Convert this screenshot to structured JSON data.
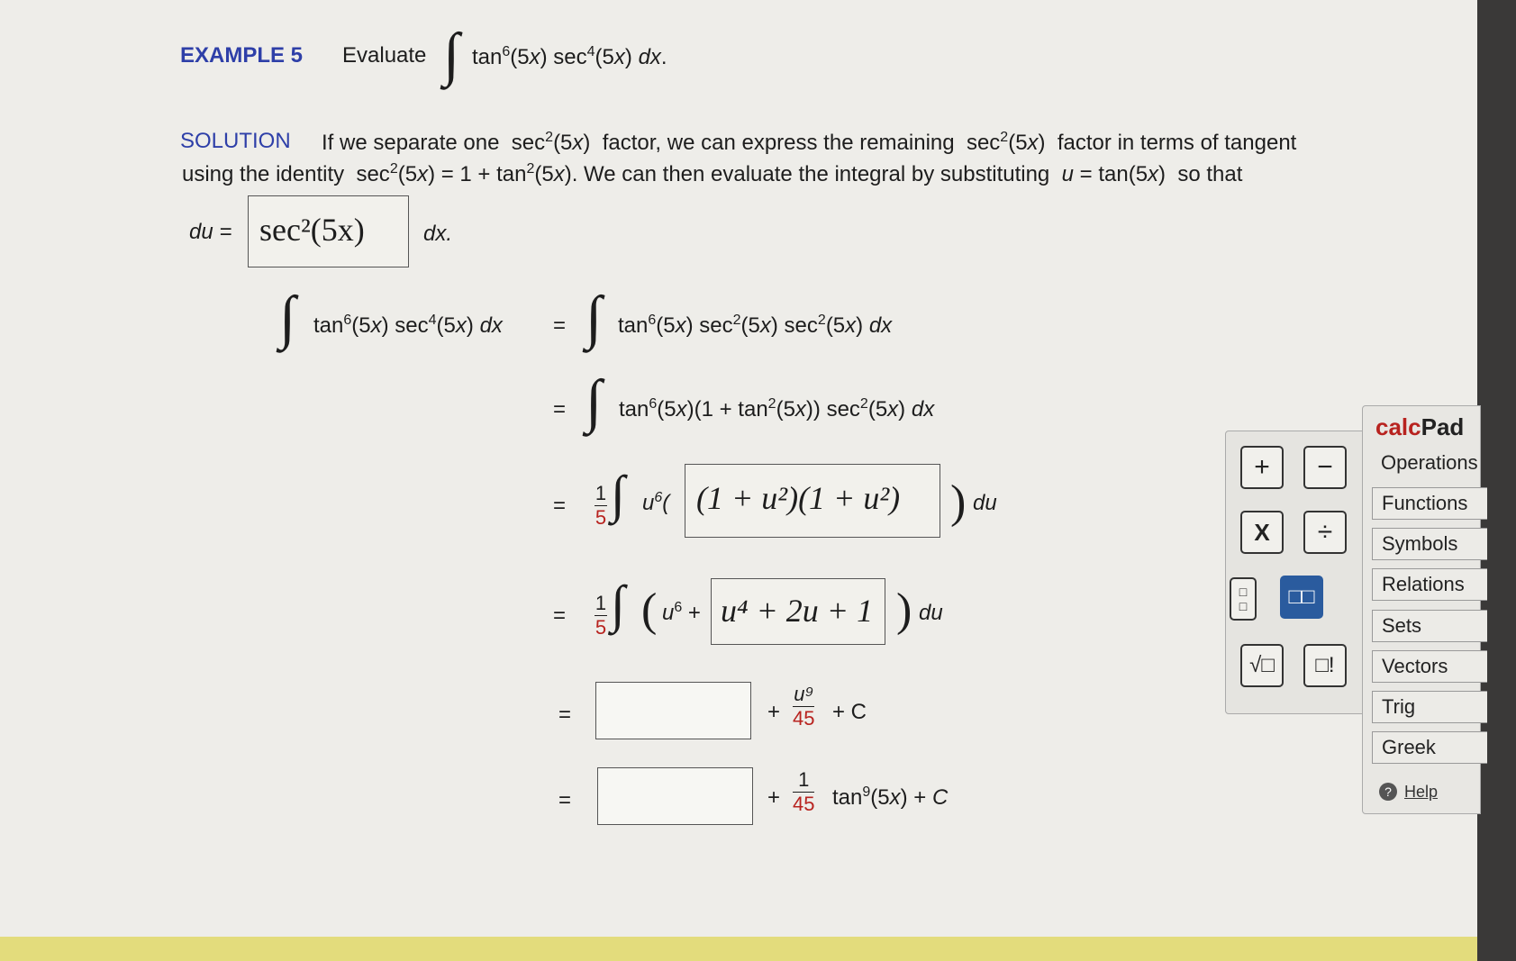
{
  "example": {
    "label": "EXAMPLE 5",
    "evaluate": "Evaluate",
    "integrand": "tan6(5x) sec4(5x) dx."
  },
  "solution": {
    "label": "SOLUTION",
    "line1a": "If we separate one",
    "line1b": "factor, we can express the remaining",
    "line1c": "factor in terms of tangent",
    "line2a": "using the identity",
    "line2b": ". We can then evaluate the integral by substituting",
    "line2c": "so that",
    "du_label": "du =",
    "du_box": "sec²(5x)",
    "dx_label": "dx."
  },
  "steps": {
    "lhs": "tan⁶(5x) sec⁴(5x) dx",
    "eq": "=",
    "s1": "tan⁶(5x) sec²(5x) sec²(5x) dx",
    "s2": "tan⁶(5x)(1 + tan²(5x)) sec²(5x) dx",
    "s3_pre": "u⁶(",
    "s3_box": "(1 + u²)(1 + u²)",
    "s3_post": ") du",
    "s4_pre": "(u⁶ +",
    "s4_box": "u⁴ + 2u + 1",
    "s4_post": ") du",
    "s5_plus": "+",
    "s5_num": "u⁹",
    "s5_den": "45",
    "s5_c": "+ C",
    "s6_plus": "+",
    "s6_num": "1",
    "s6_den": "45",
    "s6_tail": "tan⁹(5x) + C",
    "frac_num": "1",
    "frac_den": "5",
    "box5_value": "",
    "box6_value": ""
  },
  "calcpad": {
    "title_a": "calc",
    "title_b": "Pad",
    "keys": [
      "+",
      "−",
      "X",
      "÷",
      "□/□",
      "□□",
      "√□",
      "□!"
    ],
    "tabs": [
      "Operations",
      "Functions",
      "Symbols",
      "Relations",
      "Sets",
      "Vectors",
      "Trig",
      "Greek"
    ],
    "help": "Help"
  }
}
